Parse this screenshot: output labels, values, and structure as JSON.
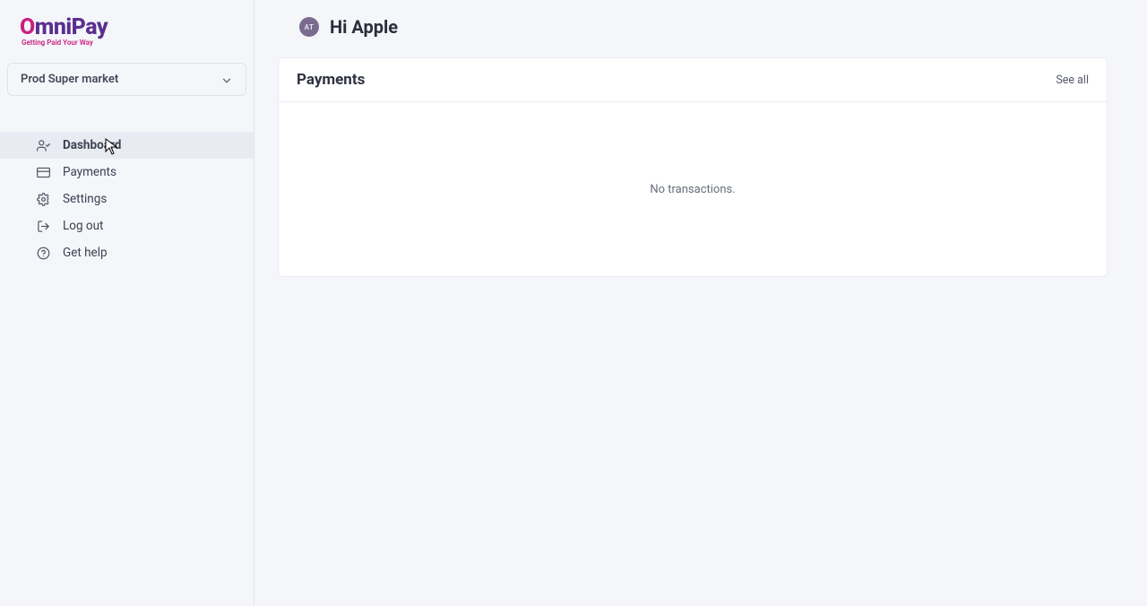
{
  "brand": {
    "name_part1": "O",
    "name_part2": "mniPay",
    "tagline": "Getting Paid Your Way"
  },
  "merchant_selector": {
    "selected": "Prod Super market"
  },
  "sidebar": {
    "items": [
      {
        "label": "Dashboard",
        "active": true
      },
      {
        "label": "Payments",
        "active": false
      },
      {
        "label": "Settings",
        "active": false
      },
      {
        "label": "Log out",
        "active": false
      },
      {
        "label": "Get help",
        "active": false
      }
    ]
  },
  "header": {
    "avatar_initials": "AT",
    "greeting": "Hi Apple"
  },
  "payments_card": {
    "title": "Payments",
    "see_all": "See all",
    "empty_message": "No transactions."
  }
}
